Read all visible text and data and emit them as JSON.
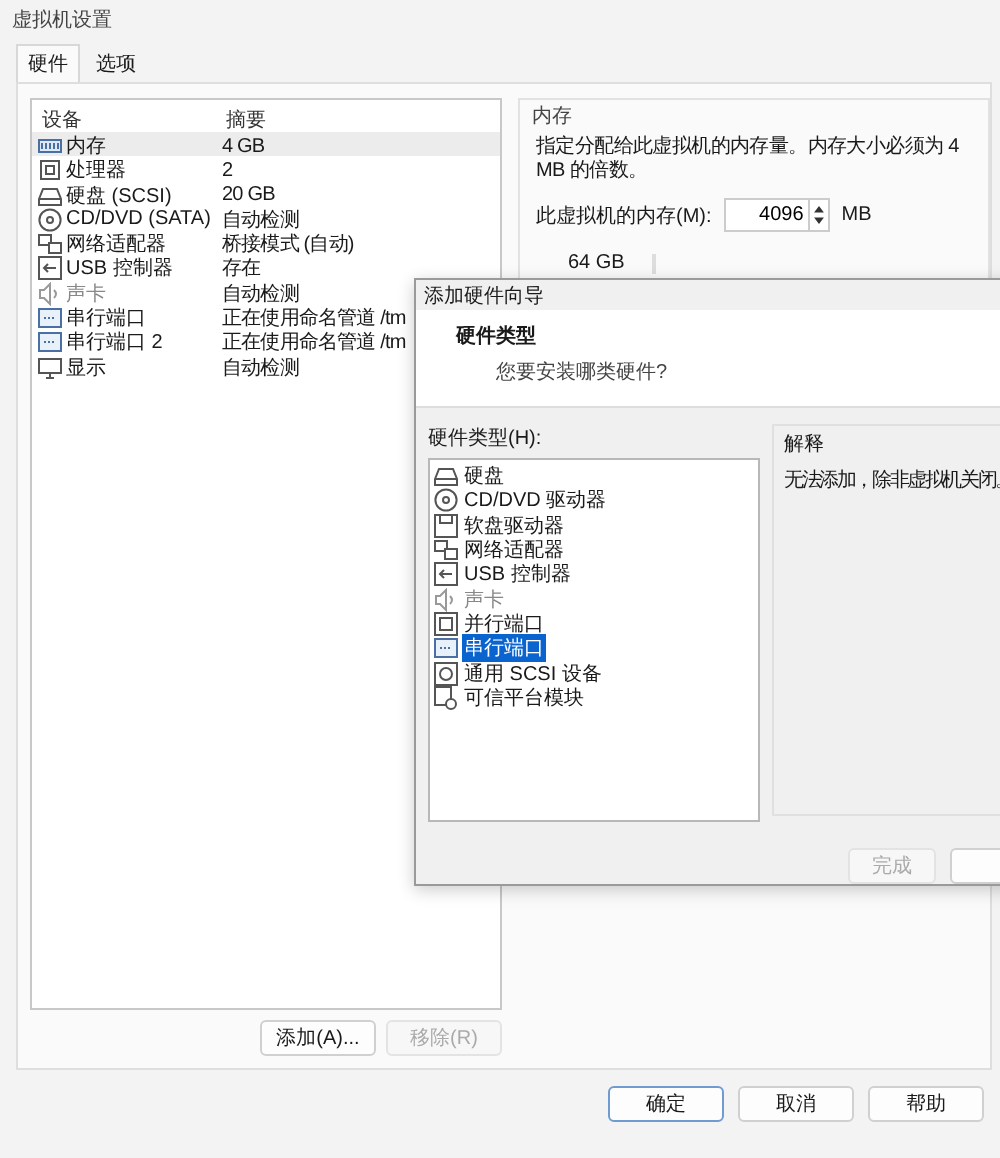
{
  "window": {
    "title": "虚拟机设置"
  },
  "tabs": [
    {
      "label": "硬件",
      "selected": true
    },
    {
      "label": "选项",
      "selected": false
    }
  ],
  "device_list": {
    "columns": [
      "设备",
      "摘要"
    ],
    "rows": [
      {
        "kind": "memory",
        "device": "内存",
        "summary": "4 GB",
        "selected": true,
        "disabled": false
      },
      {
        "kind": "cpu",
        "device": "处理器",
        "summary": "2",
        "selected": false,
        "disabled": false
      },
      {
        "kind": "disk",
        "device": "硬盘 (SCSI)",
        "summary": "20 GB",
        "selected": false,
        "disabled": false
      },
      {
        "kind": "cdrom",
        "device": "CD/DVD (SATA)",
        "summary": "自动检测",
        "selected": false,
        "disabled": false
      },
      {
        "kind": "network",
        "device": "网络适配器",
        "summary": "桥接模式 (自动)",
        "selected": false,
        "disabled": false
      },
      {
        "kind": "usb",
        "device": "USB 控制器",
        "summary": "存在",
        "selected": false,
        "disabled": false
      },
      {
        "kind": "sound",
        "device": "声卡",
        "summary": "自动检测",
        "selected": false,
        "disabled": true
      },
      {
        "kind": "serial",
        "device": "串行端口",
        "summary": "正在使用命名管道 /tm",
        "selected": false,
        "disabled": false
      },
      {
        "kind": "serial",
        "device": "串行端口 2",
        "summary": "正在使用命名管道 /tm",
        "selected": false,
        "disabled": false
      },
      {
        "kind": "display",
        "device": "显示",
        "summary": "自动检测",
        "selected": false,
        "disabled": false
      }
    ]
  },
  "list_buttons": [
    {
      "label": "添加(A)...",
      "disabled": false
    },
    {
      "label": "移除(R)",
      "disabled": true
    }
  ],
  "memory_panel": {
    "title": "内存",
    "description": "指定分配给此虚拟机的内存量。内存大小必须为 4 MB 的倍数。",
    "field_label": "此虚拟机的内存(M):",
    "value": "4096",
    "unit": "MB",
    "scale_label": "64 GB"
  },
  "wizard": {
    "title": "添加硬件向导",
    "heading": "硬件类型",
    "subheading": "您要安装哪类硬件?",
    "list_label": "硬件类型(H):",
    "items": [
      {
        "kind": "disk",
        "label": "硬盘",
        "selected": false,
        "disabled": false
      },
      {
        "kind": "cdrom",
        "label": "CD/DVD 驱动器",
        "selected": false,
        "disabled": false
      },
      {
        "kind": "floppy",
        "label": "软盘驱动器",
        "selected": false,
        "disabled": false
      },
      {
        "kind": "network",
        "label": "网络适配器",
        "selected": false,
        "disabled": false
      },
      {
        "kind": "usb",
        "label": "USB 控制器",
        "selected": false,
        "disabled": false
      },
      {
        "kind": "sound",
        "label": "声卡",
        "selected": false,
        "disabled": true
      },
      {
        "kind": "parallel",
        "label": "并行端口",
        "selected": false,
        "disabled": false
      },
      {
        "kind": "serial",
        "label": "串行端口",
        "selected": true,
        "disabled": false
      },
      {
        "kind": "scsi",
        "label": "通用 SCSI 设备",
        "selected": false,
        "disabled": false
      },
      {
        "kind": "tpm",
        "label": "可信平台模块",
        "selected": false,
        "disabled": false
      }
    ],
    "explanation_title": "解释",
    "explanation": "无法添加，除非虚拟机关闭。",
    "buttons": [
      {
        "label": "完成",
        "disabled": true
      }
    ]
  },
  "buttons": [
    {
      "label": "确定",
      "focused": true
    },
    {
      "label": "取消",
      "focused": false
    },
    {
      "label": "帮助",
      "focused": false
    }
  ]
}
